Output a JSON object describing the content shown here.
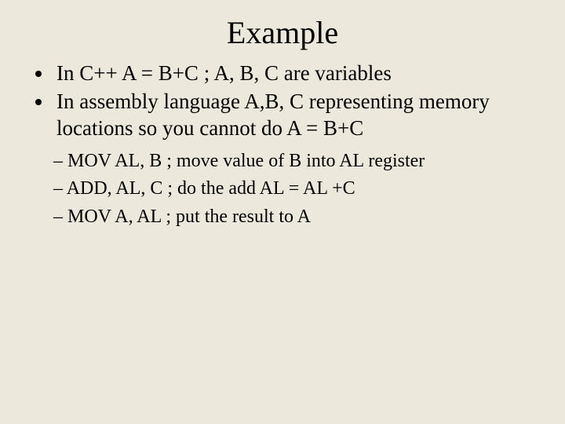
{
  "title": "Example",
  "bullets": [
    "In C++ A = B+C ; A, B, C are variables",
    "In assembly language A,B, C representing memory locations so you cannot do A = B+C"
  ],
  "subbullets": [
    "MOV AL, B   ; move value of B into AL register",
    "ADD, AL, C ; do the add AL = AL +C",
    "MOV A, AL  ; put the result to A"
  ]
}
